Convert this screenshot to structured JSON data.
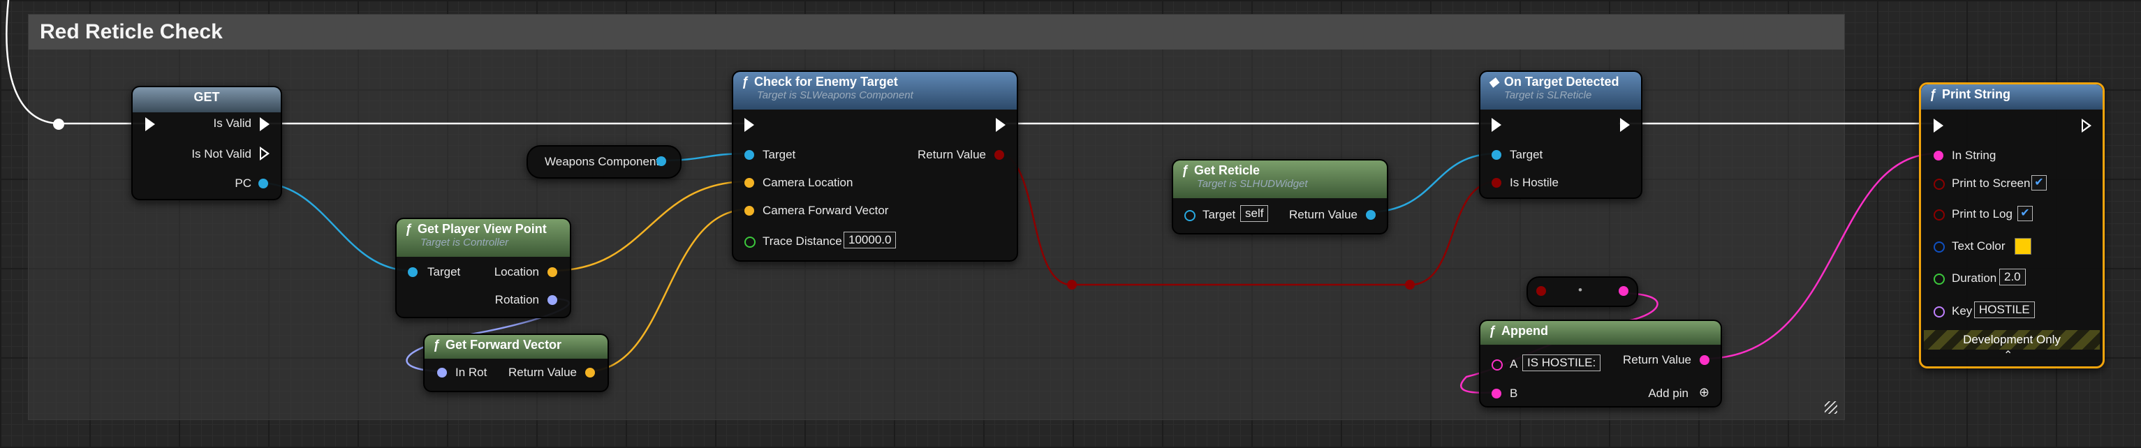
{
  "comment": {
    "title": "Red Reticle Check"
  },
  "nodes": {
    "get": {
      "title": "GET",
      "is_valid": "Is Valid",
      "is_not_valid": "Is Not Valid",
      "pc": "PC"
    },
    "weapons_component": {
      "label": "Weapons Component"
    },
    "get_player_view_point": {
      "title": "Get Player View Point",
      "subtitle": "Target is Controller",
      "target": "Target",
      "location": "Location",
      "rotation": "Rotation"
    },
    "get_forward_vector": {
      "title": "Get Forward Vector",
      "in_rot": "In Rot",
      "return_value": "Return Value"
    },
    "check_enemy": {
      "title": "Check for Enemy Target",
      "subtitle": "Target is SLWeapons Component",
      "target": "Target",
      "camera_location": "Camera Location",
      "camera_forward": "Camera Forward Vector",
      "trace_distance": "Trace Distance",
      "trace_value": "10000.0",
      "return_value": "Return Value"
    },
    "get_reticle": {
      "title": "Get Reticle",
      "subtitle": "Target is SLHUDWidget",
      "target": "Target",
      "target_value": "self",
      "return_value": "Return Value"
    },
    "on_target_detected": {
      "title": "On Target Detected",
      "subtitle": "Target is SLReticle",
      "target": "Target",
      "is_hostile": "Is Hostile"
    },
    "append": {
      "title": "Append",
      "a": "A",
      "a_value": "IS HOSTILE:",
      "b": "B",
      "return_value": "Return Value",
      "add_pin": "Add pin"
    },
    "print_string": {
      "title": "Print String",
      "in_string": "In String",
      "print_to_screen": "Print to Screen",
      "print_to_log": "Print to Log",
      "text_color": "Text Color",
      "duration": "Duration",
      "duration_value": "2.0",
      "key": "Key",
      "key_value": "HOSTILE",
      "dev_only": "Development Only"
    }
  },
  "colors": {
    "exec": "#ffffff",
    "object": "#29a9e0",
    "vector": "#f4b324",
    "rotator": "#9aa8ff",
    "bool": "#8c0000",
    "string": "#ff30c8",
    "float": "#3cc83c",
    "struct": "#1050c0",
    "name": "#c080ff",
    "print_string_border": "#f2a40c"
  }
}
